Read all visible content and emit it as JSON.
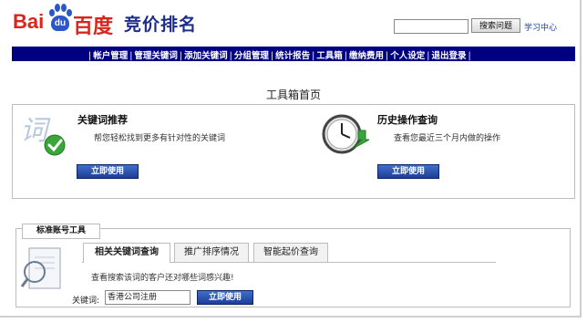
{
  "brand": {
    "logo_bai": "Bai",
    "logo_du": "du",
    "logo_baidu_cn": "百度",
    "product_name": "竞价排名"
  },
  "header": {
    "search_button": "搜索问题",
    "learn_link": "学习中心"
  },
  "nav": {
    "items": [
      "帐户管理",
      "管理关键词",
      "添加关键词",
      "分组管理",
      "统计报告",
      "工具箱",
      "缴纳费用",
      "个人设定",
      "退出登录"
    ]
  },
  "page_title": "工具箱首页",
  "tools": [
    {
      "title": "关键词推荐",
      "description": "帮您轻松找到更多有针对性的关键词",
      "button": "立即使用",
      "icon": "keyword-check-icon"
    },
    {
      "title": "历史操作查询",
      "description": "查看您最近三个月内做的操作",
      "button": "立即使用",
      "icon": "clock-icon"
    }
  ],
  "standard_tools": {
    "section_title": "标准账号工具",
    "tabs": [
      {
        "label": "相关关键词查询",
        "active": true
      },
      {
        "label": "推广排序情况",
        "active": false
      },
      {
        "label": "智能起价查询",
        "active": false
      }
    ],
    "description": "查看搜索该词的客户还对哪些词感兴趣!",
    "keyword_label": "关键词:",
    "keyword_value": "香港公司注册",
    "button": "立即使用",
    "icon": "magnifier-document-icon"
  },
  "colors": {
    "nav_bg": "#000080",
    "brand_red": "#d9261c",
    "brand_blue": "#2b57c7",
    "button_blue": "#1d3e96"
  }
}
